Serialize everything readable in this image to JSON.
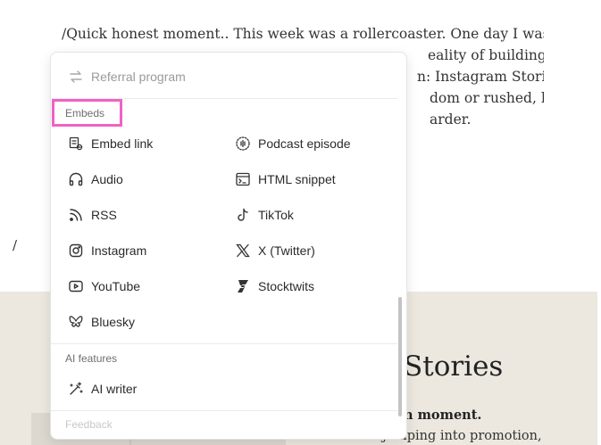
{
  "editor": {
    "lines": [
      "/Quick honest moment.. This week was a rollercoaster. One day I was in flow,",
      "                                                        eality of building",
      "                                                        n: Instagram Stories",
      "                                                        dom or rushed, here",
      "                                                        arder."
    ],
    "slash": "/"
  },
  "background_section": {
    "heading": "Stories",
    "subheading": "n moment.",
    "body": "Instead of jumping into promotion,"
  },
  "menu": {
    "top_item": {
      "label": "Referral program",
      "icon": "arrows-swap-icon"
    },
    "sections": [
      {
        "label": "Embeds",
        "items": [
          {
            "label": "Embed link",
            "icon": "embed-link-icon"
          },
          {
            "label": "Podcast episode",
            "icon": "podcast-icon"
          },
          {
            "label": "Audio",
            "icon": "headphones-icon"
          },
          {
            "label": "HTML snippet",
            "icon": "code-snippet-icon"
          },
          {
            "label": "RSS",
            "icon": "rss-icon"
          },
          {
            "label": "TikTok",
            "icon": "tiktok-icon"
          },
          {
            "label": "Instagram",
            "icon": "instagram-icon"
          },
          {
            "label": "X (Twitter)",
            "icon": "x-twitter-icon"
          },
          {
            "label": "YouTube",
            "icon": "youtube-icon"
          },
          {
            "label": "Stocktwits",
            "icon": "stocktwits-icon"
          },
          {
            "label": "Bluesky",
            "icon": "bluesky-icon"
          }
        ]
      },
      {
        "label": "AI features",
        "items": [
          {
            "label": "AI writer",
            "icon": "ai-wand-icon"
          }
        ]
      }
    ],
    "faded_label": "Feedback"
  },
  "colors": {
    "highlight": "#f062c4",
    "background_section": "#ece8df"
  }
}
